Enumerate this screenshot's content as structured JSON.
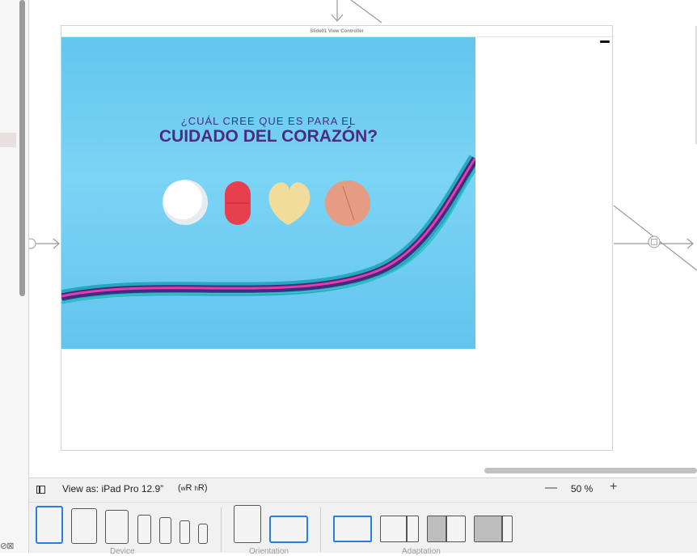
{
  "scene": {
    "title": "Slide01 View Controller",
    "slide_text_line1": "¿CUÁL CREE QUE ES PARA EL",
    "slide_text_line2": "CUIDADO DEL CORAZÓN?"
  },
  "bottom_bar": {
    "view_as": "View as: iPad Pro 12.9”",
    "size_class_w": "w",
    "size_class_wv": "R",
    "size_class_h": "h",
    "size_class_hv": "R",
    "zoom_out": "—",
    "zoom_level": "50 %",
    "zoom_in": "+"
  },
  "tray": {
    "device_label": "Device",
    "orientation_label": "Orientation",
    "adaptation_label": "Adaptation"
  },
  "colors": {
    "selection": "#2a7de1",
    "slide_text": "#4b2c82",
    "slide_background": "#6ccbf0"
  }
}
